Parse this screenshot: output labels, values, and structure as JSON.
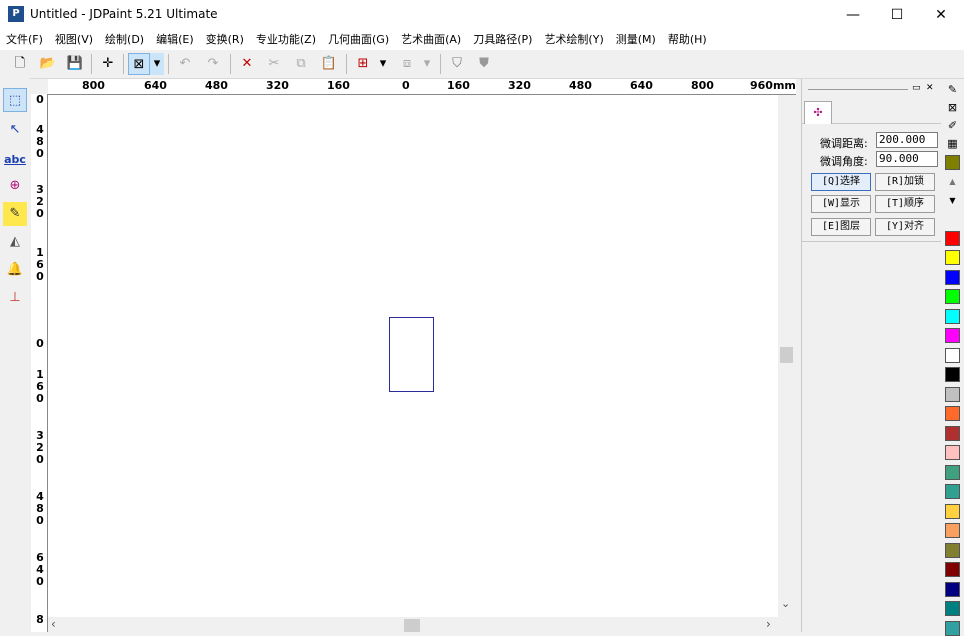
{
  "window": {
    "logo": "P",
    "title": "Untitled - JDPaint 5.21 Ultimate",
    "minimize": "—",
    "maximize": "☐",
    "close": "✕"
  },
  "menu": [
    "文件(F)",
    "视图(V)",
    "绘制(D)",
    "编辑(E)",
    "变换(R)",
    "专业功能(Z)",
    "几何曲面(G)",
    "艺术曲面(A)",
    "刀具路径(P)",
    "艺术绘制(Y)",
    "测量(M)",
    "帮助(H)"
  ],
  "toolbar": [
    {
      "name": "new-file-icon",
      "glyph": "🗋",
      "enabled": true
    },
    {
      "name": "open-folder-icon",
      "glyph": "📂",
      "enabled": true
    },
    {
      "name": "save-icon",
      "glyph": "💾",
      "enabled": true
    },
    {
      "name": "crosshair-icon",
      "glyph": "✛",
      "enabled": true
    },
    {
      "name": "window-select-icon",
      "glyph": "⊠",
      "enabled": true
    },
    {
      "name": "dropdown-arrow-icon",
      "glyph": "▾",
      "enabled": true
    },
    {
      "name": "undo-icon",
      "glyph": "↶",
      "enabled": false
    },
    {
      "name": "redo-icon",
      "glyph": "↷",
      "enabled": false
    },
    {
      "name": "delete-icon",
      "glyph": "✕",
      "enabled": true
    },
    {
      "name": "cut-icon",
      "glyph": "✂",
      "enabled": false
    },
    {
      "name": "copy-icon",
      "glyph": "⧉",
      "enabled": false
    },
    {
      "name": "paste-icon",
      "glyph": "📋",
      "enabled": false
    },
    {
      "name": "grid-snap-icon",
      "glyph": "⊞",
      "enabled": true
    },
    {
      "name": "dropdown-arrow-icon",
      "glyph": "▾",
      "enabled": true
    },
    {
      "name": "cube-view-icon",
      "glyph": "⧈",
      "enabled": false
    },
    {
      "name": "dropdown-arrow-icon",
      "glyph": "▾",
      "enabled": false
    },
    {
      "name": "shield-render-icon",
      "glyph": "⛉",
      "enabled": true
    },
    {
      "name": "shield-solid-icon",
      "glyph": "⛊",
      "enabled": true
    }
  ],
  "left_tools": [
    {
      "name": "select-tool-icon",
      "glyph": "⬚"
    },
    {
      "name": "node-edit-tool-icon",
      "glyph": "↖"
    },
    {
      "name": "text-tool-icon",
      "glyph": "abc"
    },
    {
      "name": "transform-tool-icon",
      "glyph": "⊕"
    },
    {
      "name": "pencil-tool-icon",
      "glyph": "✎"
    },
    {
      "name": "eraser-tool-icon",
      "glyph": "◭"
    },
    {
      "name": "bell-tool-icon",
      "glyph": "🔔"
    },
    {
      "name": "measure-tool-icon",
      "glyph": "⊥"
    }
  ],
  "hruler": [
    "800",
    "640",
    "480",
    "320",
    "160",
    "0",
    "160",
    "320",
    "480",
    "640",
    "800",
    "960mm"
  ],
  "vruler": [
    [
      "0"
    ],
    [
      "4",
      "8",
      "0"
    ],
    [
      "3",
      "2",
      "0"
    ],
    [
      "1",
      "6",
      "0"
    ],
    [
      "0"
    ],
    [
      "1",
      "6",
      "0"
    ],
    [
      "3",
      "2",
      "0"
    ],
    [
      "4",
      "8",
      "0"
    ],
    [
      "6",
      "4",
      "0"
    ],
    [
      "8"
    ]
  ],
  "panel": {
    "pin": "▭",
    "close": "✕",
    "tab_icon": "✣",
    "fine_distance_label": "微调距离:",
    "fine_distance_value": "200.000",
    "fine_angle_label": "微调角度:",
    "fine_angle_value": "90.000",
    "buttons": [
      "[Q]选择",
      "[R]加锁",
      "[W]显示",
      "[T]顺序",
      "[E]图层",
      "[Y]对齐"
    ]
  },
  "scroll": {
    "up": "▲",
    "down": "▼",
    "left": "◀",
    "right": "▶",
    "vdown": "⌄",
    "hleft": "‹",
    "hright": "›"
  },
  "palette": {
    "tools": [
      {
        "name": "pen-icon",
        "glyph": "✎"
      },
      {
        "name": "no-fill-icon",
        "glyph": "⊠"
      },
      {
        "name": "eyedropper-icon",
        "glyph": "✐"
      },
      {
        "name": "hatch-fill-icon",
        "glyph": "▦"
      }
    ],
    "colors": [
      "#808000",
      "#ff0000",
      "#ffff00",
      "#0000ff",
      "#00ff00",
      "#00ffff",
      "#ff00ff",
      "#ffffff",
      "#000000",
      "#c0c0c0",
      "#ff6a2a",
      "#b03030",
      "#ffc0c0",
      "#40a080",
      "#30a090",
      "#ffd040",
      "#f8a060",
      "#808030",
      "#800000",
      "#000080",
      "#008080",
      "#30a0a0"
    ]
  }
}
